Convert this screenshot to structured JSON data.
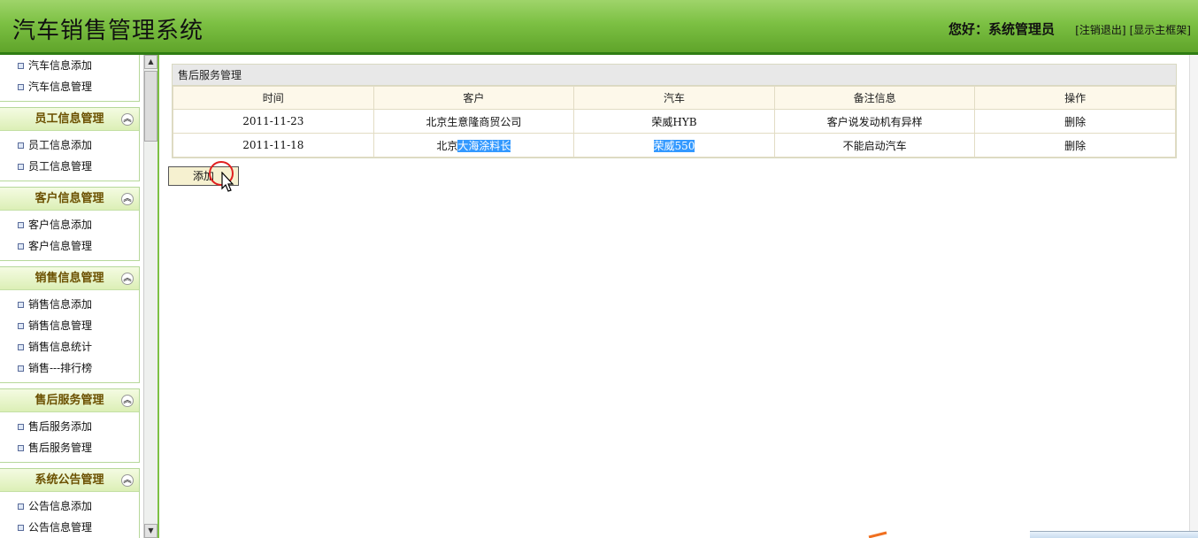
{
  "header": {
    "title": "汽车销售管理系统",
    "greeting": "您好：系统管理员",
    "logout": "[注销退出]",
    "show_frame": "[显示主框架]"
  },
  "sidebar": {
    "top_items": [
      "汽车信息添加",
      "汽车信息管理"
    ],
    "sections": [
      {
        "title": "员工信息管理",
        "items": [
          "员工信息添加",
          "员工信息管理"
        ]
      },
      {
        "title": "客户信息管理",
        "items": [
          "客户信息添加",
          "客户信息管理"
        ]
      },
      {
        "title": "销售信息管理",
        "items": [
          "销售信息添加",
          "销售信息管理",
          "销售信息统计",
          "销售---排行榜"
        ]
      },
      {
        "title": "售后服务管理",
        "items": [
          "售后服务添加",
          "售后服务管理"
        ]
      },
      {
        "title": "系统公告管理",
        "items": [
          "公告信息添加",
          "公告信息管理"
        ]
      }
    ]
  },
  "main": {
    "panel_title": "售后服务管理",
    "columns": [
      "时间",
      "客户",
      "汽车",
      "备注信息",
      "操作"
    ],
    "rows": [
      {
        "time": "2011-11-23",
        "customer": "北京生意隆商贸公司",
        "customer_selected": "",
        "car": "荣威HYB",
        "car_selected": false,
        "note": "客户说发动机有异样",
        "action": "删除"
      },
      {
        "time": "2011-11-18",
        "customer": "北京",
        "customer_selected": "大海涂料长",
        "car": "荣威550",
        "car_selected": true,
        "note": "不能启动汽车",
        "action": "删除"
      }
    ],
    "add_button": "添加"
  },
  "colors": {
    "header_green": "#7cc043",
    "header_border": "#2f7d13",
    "section_title": "#6b5000",
    "selection": "#3399ff"
  }
}
